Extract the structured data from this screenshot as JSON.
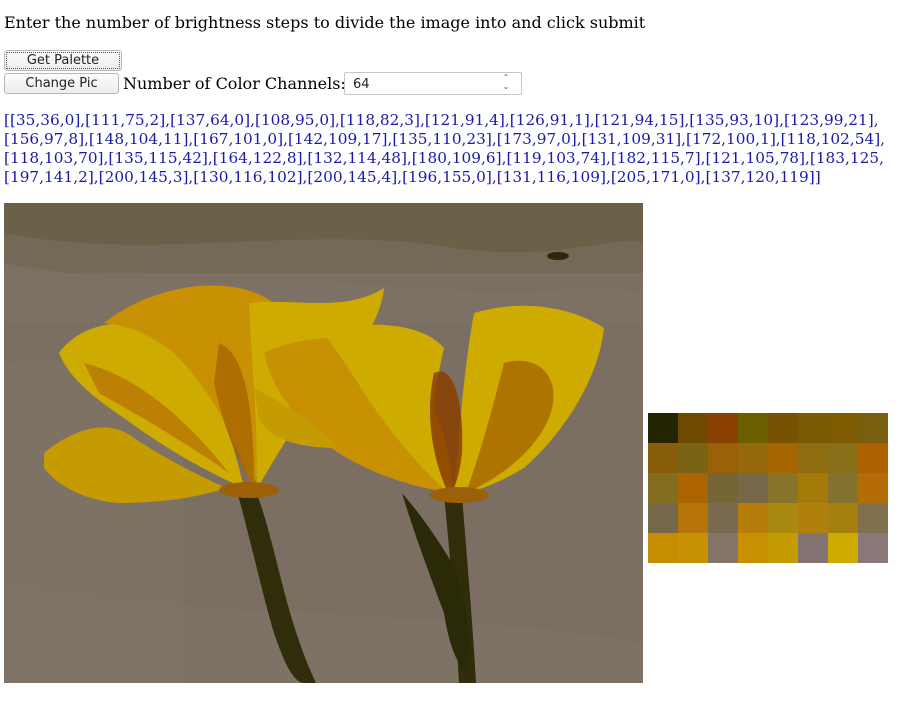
{
  "instructions": "Enter the number of brightness steps to divide the image into and click submit",
  "buttons": {
    "get_palette": "Get Palette",
    "change_pic": "Change Pic"
  },
  "channels": {
    "label": "Number of Color Channels:",
    "value": "64"
  },
  "palette_lines": [
    "[[35,36,0],[111,75,2],[137,64,0],[108,95,0],[118,82,3],[121,91,4],[126,91,1],[121,94,15],[135,93,10],[123,99,21],",
    "[156,97,8],[148,104,11],[167,101,0],[142,109,17],[135,110,23],[173,97,0],[131,109,31],[172,100,1],[118,102,54],",
    "[118,103,70],[135,115,42],[164,122,8],[132,114,48],[180,109,6],[119,103,74],[182,115,7],[121,105,78],[183,125,",
    "[197,141,2],[200,145,3],[130,116,102],[200,145,4],[196,155,0],[131,116,109],[205,171,0],[137,120,119]]"
  ],
  "colors": {
    "link_text": "#1a1aa8",
    "swatches": [
      "#232400",
      "#6f4b02",
      "#894000",
      "#6c5f00",
      "#765203",
      "#795b04",
      "#7e5b01",
      "#795e0f",
      "#875d0a",
      "#7b6315",
      "#9c6108",
      "#94680b",
      "#a76500",
      "#8e6d11",
      "#876e17",
      "#ad6100",
      "#836d1f",
      "#ac6401",
      "#766636",
      "#766746",
      "#87732a",
      "#a47a08",
      "#847230",
      "#b46d06",
      "#77674a",
      "#b67307",
      "#79694e",
      "#b77d0a",
      "#a88a10",
      "#b0800b",
      "#a47f0e",
      "#80704e",
      "#c58d02",
      "#c89103",
      "#827466",
      "#c89104",
      "#c49b00",
      "#837472",
      "#cdab00",
      "#897877"
    ]
  },
  "icons": {
    "spinner": "spin-up-down-arrows-icon"
  }
}
